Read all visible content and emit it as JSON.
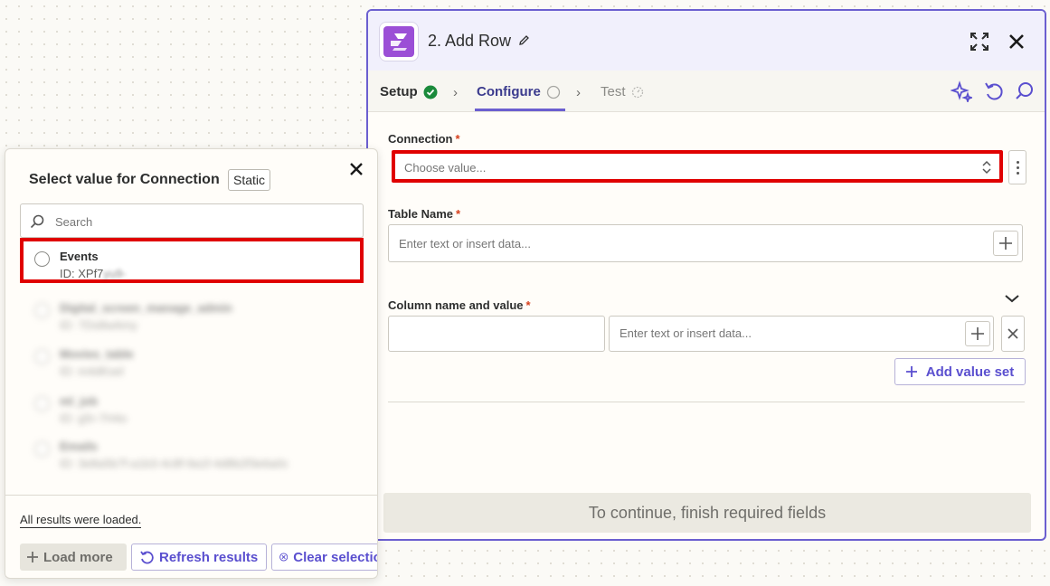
{
  "step": {
    "title": "2. Add Row",
    "tabs": [
      {
        "label": "Setup",
        "status": "complete"
      },
      {
        "label": "Configure",
        "status": "active"
      },
      {
        "label": "Test",
        "status": "pending"
      }
    ]
  },
  "form": {
    "connection": {
      "label": "Connection",
      "required": "*",
      "placeholder": "Choose value..."
    },
    "table_name": {
      "label": "Table Name",
      "required": "*",
      "placeholder": "Enter text or insert data..."
    },
    "column": {
      "label": "Column name and value",
      "required": "*",
      "name_value": "",
      "value_placeholder": "Enter text or insert data..."
    },
    "add_value_set": "Add value set",
    "continue_label": "To continue, finish required fields"
  },
  "popover": {
    "title": "Select value for Connection",
    "badge": "Static",
    "search_placeholder": "Search",
    "items": [
      {
        "name": "Events",
        "id": "ID: XPf7",
        "id_blurred": "yu9-"
      },
      {
        "name": "Digital_screen_manage_admin",
        "id": "ID: 7Ds8wAmy"
      },
      {
        "name": "Movies_table",
        "id": "ID: m4dKsel"
      },
      {
        "name": "ml_job",
        "id": "ID: g5r-7H4o"
      },
      {
        "name": "Emails",
        "id": "ID: 3e8a5b7f-a1b3-4c8f-9a1f-4d8b2f3e6a0c"
      }
    ],
    "loaded_text": "All results were loaded.",
    "load_more": "Load more",
    "refresh": "Refresh results",
    "clear": "Clear selection"
  },
  "colors": {
    "accent": "#6b5fd0",
    "highlight": "#e00000",
    "success": "#1a8a3b"
  }
}
